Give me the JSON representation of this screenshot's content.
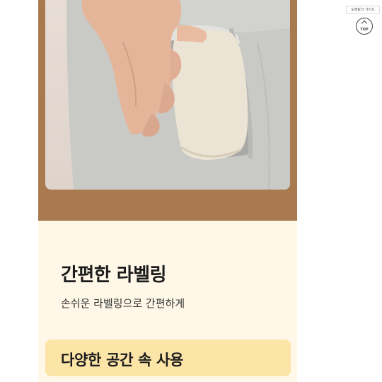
{
  "feature": {
    "title": "간편한 라벨링",
    "description": "손쉬운 라벨링으로 간편하게"
  },
  "usage_banner": {
    "label": "다양한 공간 속 사용"
  },
  "floating": {
    "guide_label": "도매링크 가이드",
    "top_button_label": "TOP",
    "top_icon": "chevron-up-icon"
  },
  "colors": {
    "frame": "#a87a4e",
    "panel_background": "#fff8e8",
    "banner_background": "#fde5a8"
  }
}
